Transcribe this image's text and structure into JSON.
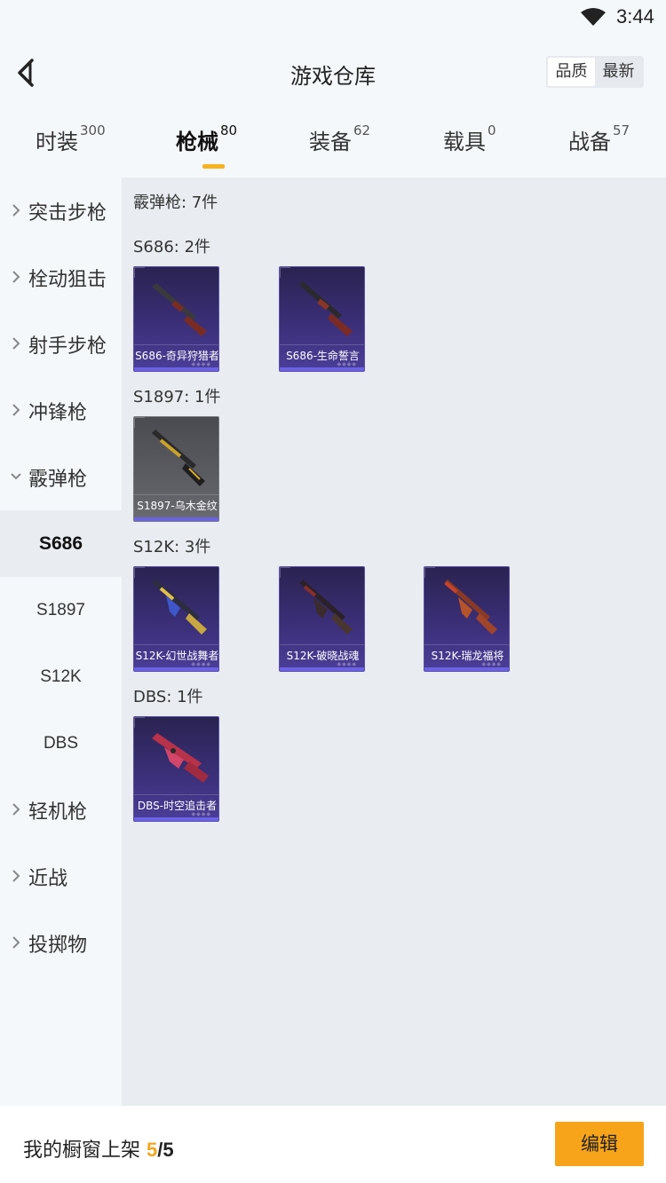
{
  "status_bar": {
    "time": "3:44",
    "wifi_icon": "wifi-icon"
  },
  "header": {
    "back_icon": "back-arrow-icon",
    "title": "游戏仓库",
    "sort_options": [
      "品质",
      "最新"
    ]
  },
  "tabs": [
    {
      "label": "时装",
      "count": "300"
    },
    {
      "label": "枪械",
      "count": "80"
    },
    {
      "label": "装备",
      "count": "62"
    },
    {
      "label": "载具",
      "count": "0"
    },
    {
      "label": "战备",
      "count": "57"
    }
  ],
  "sidebar": {
    "categories": [
      {
        "label": "突击步枪"
      },
      {
        "label": "栓动狙击"
      },
      {
        "label": "射手步枪"
      },
      {
        "label": "冲锋枪"
      },
      {
        "label": "霰弹枪"
      }
    ],
    "subitems": [
      {
        "label": "S686"
      },
      {
        "label": "S1897"
      },
      {
        "label": "S12K"
      },
      {
        "label": "DBS"
      }
    ],
    "categories_after": [
      {
        "label": "轻机枪"
      },
      {
        "label": "近战"
      },
      {
        "label": "投掷物"
      }
    ]
  },
  "content": {
    "category_header": "霰弹枪: 7件",
    "groups": [
      {
        "header": "S686: 2件",
        "items": [
          "S686-奇异狩猎者",
          "S686-生命誓言"
        ]
      },
      {
        "header": "S1897: 1件",
        "items": [
          "S1897-乌木金纹"
        ]
      },
      {
        "header": "S12K: 3件",
        "items": [
          "S12K-幻世战舞者",
          "S12K-破晓战魂",
          "S12K-瑞龙福将"
        ]
      },
      {
        "header": "DBS: 1件",
        "items": [
          "DBS-时空追击者"
        ]
      }
    ]
  },
  "bottom": {
    "showcase_label": "我的橱窗上架",
    "showcase_current": "5",
    "showcase_total": "/5",
    "edit_label": "编辑"
  },
  "colors": {
    "accent": "#f8a41a",
    "card_purple": "#3b2f78",
    "card_gray": "#5c5d63"
  }
}
